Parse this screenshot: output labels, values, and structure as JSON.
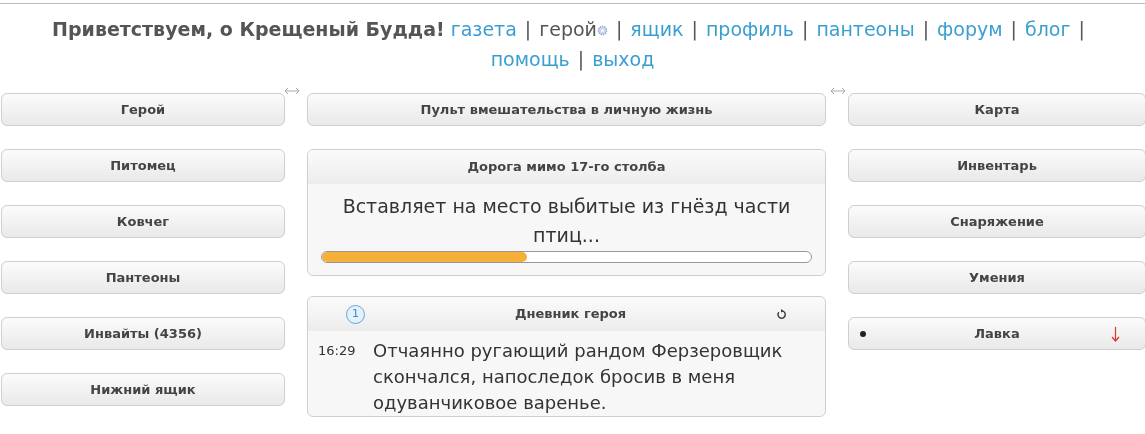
{
  "header": {
    "greeting": "Приветствуем, о Крещеный Будда!",
    "nav": [
      {
        "label": "газета",
        "selected": false,
        "separator": "|"
      },
      {
        "label": "герой",
        "selected": true,
        "separator": "|"
      },
      {
        "label": "ящик",
        "selected": false,
        "separator": "|"
      },
      {
        "label": "профиль",
        "selected": false,
        "separator": "|"
      },
      {
        "label": "пантеоны",
        "selected": false,
        "separator": "|"
      },
      {
        "label": "форум",
        "selected": false,
        "separator": "|"
      },
      {
        "label": "блог",
        "selected": false,
        "separator": "|"
      },
      {
        "label": "помощь",
        "selected": false,
        "separator": "|"
      },
      {
        "label": "выход",
        "selected": false
      }
    ]
  },
  "left_blocks": [
    "Герой",
    "Питомец",
    "Ковчег",
    "Пантеоны",
    "Инвайты (4356)",
    "Нижний ящик"
  ],
  "center": {
    "control_panel": "Пульт вмешательства в личную жизнь",
    "quest": {
      "title": "Дорога мимо 17-го столба",
      "text": "Вставляет на место выбитые из гнёзд части птиц...",
      "level": 0.42
    },
    "diary": {
      "badge": "1",
      "title": "Дневник героя",
      "entries": [
        {
          "time": "16:29",
          "text": "Отчаянно ругающий рандом Ферзеровщик скончался, напоследок бросив в меня одуванчиковое варенье."
        }
      ]
    }
  },
  "right_blocks": [
    {
      "label": "Карта",
      "marked": false
    },
    {
      "label": "Инвентарь",
      "marked": false
    },
    {
      "label": "Снаряжение",
      "marked": false
    },
    {
      "label": "Умения",
      "marked": false
    },
    {
      "label": "Лавка",
      "marked": true
    }
  ]
}
